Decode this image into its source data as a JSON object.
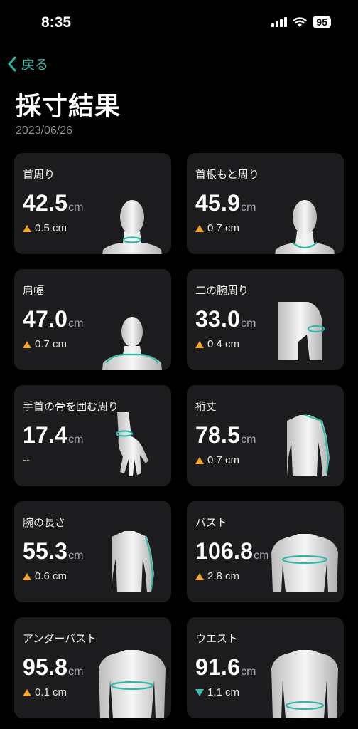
{
  "status": {
    "time": "8:35",
    "battery": "95"
  },
  "nav": {
    "back_label": "戻る"
  },
  "page": {
    "title": "採寸結果",
    "date": "2023/06/26"
  },
  "colors": {
    "accent": "#2fb8a6",
    "up": "#f5a623",
    "down": "#3cc0ae",
    "card_bg": "#1c1c1e"
  },
  "measurements": [
    {
      "label": "首周り",
      "value": "42.5",
      "unit": "cm",
      "change": "0.5 cm",
      "trend": "up",
      "figure": "neck-figure-icon"
    },
    {
      "label": "首根もと周り",
      "value": "45.9",
      "unit": "cm",
      "change": "0.7 cm",
      "trend": "up",
      "figure": "neck-base-figure-icon"
    },
    {
      "label": "肩幅",
      "value": "47.0",
      "unit": "cm",
      "change": "0.7 cm",
      "trend": "up",
      "figure": "shoulder-figure-icon"
    },
    {
      "label": "二の腕周り",
      "value": "33.0",
      "unit": "cm",
      "change": "0.4 cm",
      "trend": "up",
      "figure": "upper-arm-figure-icon"
    },
    {
      "label": "手首の骨を囲む周り",
      "value": "17.4",
      "unit": "cm",
      "change": "--",
      "trend": "none",
      "figure": "wrist-figure-icon"
    },
    {
      "label": "裄丈",
      "value": "78.5",
      "unit": "cm",
      "change": "0.7 cm",
      "trend": "up",
      "figure": "sleeve-length-figure-icon"
    },
    {
      "label": "腕の長さ",
      "value": "55.3",
      "unit": "cm",
      "change": "0.6 cm",
      "trend": "up",
      "figure": "arm-length-figure-icon"
    },
    {
      "label": "バスト",
      "value": "106.8",
      "unit": "cm",
      "change": "2.8 cm",
      "trend": "up",
      "figure": "bust-figure-icon"
    },
    {
      "label": "アンダーバスト",
      "value": "95.8",
      "unit": "cm",
      "change": "0.1 cm",
      "trend": "up",
      "figure": "underbust-figure-icon"
    },
    {
      "label": "ウエスト",
      "value": "91.6",
      "unit": "cm",
      "change": "1.1 cm",
      "trend": "down",
      "figure": "waist-figure-icon"
    }
  ]
}
